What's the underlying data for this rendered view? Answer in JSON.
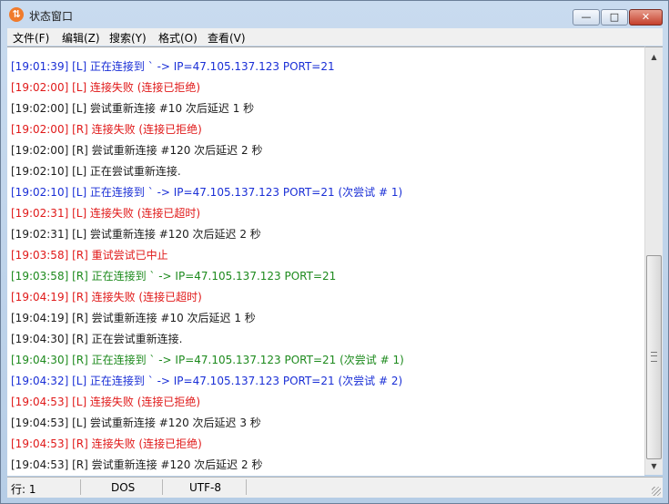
{
  "window": {
    "title": "状态窗口",
    "icon": "ftp-app-icon",
    "close_glyph": "✕",
    "min_glyph": "—",
    "max_glyph": "□"
  },
  "menu": [
    {
      "label": "文件(F)"
    },
    {
      "label": "编辑(Z)"
    },
    {
      "label": "搜索(Y)"
    },
    {
      "label": "格式(O)"
    },
    {
      "label": "查看(V)"
    }
  ],
  "log": [
    {
      "text": "[19:01:39] [L] 正在连接到 ` -> IP=47.105.137.123 PORT=21",
      "color": "blue"
    },
    {
      "text": "[19:02:00] [L] 连接失败 (连接已拒绝)",
      "color": "red"
    },
    {
      "text": "[19:02:00] [L] 尝试重新连接 #10 次后延迟 1 秒",
      "color": "black"
    },
    {
      "text": "[19:02:00] [R] 连接失败 (连接已拒绝)",
      "color": "red"
    },
    {
      "text": "[19:02:00] [R] 尝试重新连接 #120 次后延迟 2 秒",
      "color": "black"
    },
    {
      "text": "[19:02:10] [L] 正在尝试重新连接.",
      "color": "black"
    },
    {
      "text": "[19:02:10] [L] 正在连接到 ` -> IP=47.105.137.123 PORT=21 (次尝试 # 1)",
      "color": "blue"
    },
    {
      "text": "[19:02:31] [L] 连接失败 (连接已超时)",
      "color": "red"
    },
    {
      "text": "[19:02:31] [L] 尝试重新连接 #120 次后延迟 2 秒",
      "color": "black"
    },
    {
      "text": "[19:03:58] [R] 重试尝试已中止",
      "color": "red"
    },
    {
      "text": "[19:03:58] [R] 正在连接到 ` -> IP=47.105.137.123 PORT=21",
      "color": "green"
    },
    {
      "text": "[19:04:19] [R] 连接失败 (连接已超时)",
      "color": "red"
    },
    {
      "text": "[19:04:19] [R] 尝试重新连接 #10 次后延迟 1 秒",
      "color": "black"
    },
    {
      "text": "[19:04:30] [R] 正在尝试重新连接.",
      "color": "black"
    },
    {
      "text": "[19:04:30] [R] 正在连接到 ` -> IP=47.105.137.123 PORT=21 (次尝试 # 1)",
      "color": "green"
    },
    {
      "text": "[19:04:32] [L] 正在连接到 ` -> IP=47.105.137.123 PORT=21 (次尝试 # 2)",
      "color": "blue"
    },
    {
      "text": "[19:04:53] [L] 连接失败 (连接已拒绝)",
      "color": "red"
    },
    {
      "text": "[19:04:53] [L] 尝试重新连接 #120 次后延迟 3 秒",
      "color": "black"
    },
    {
      "text": "[19:04:53] [R] 连接失败 (连接已拒绝)",
      "color": "red"
    },
    {
      "text": "[19:04:53] [R] 尝试重新连接 #120 次后延迟 2 秒",
      "color": "black"
    }
  ],
  "status": {
    "position": "行: 1",
    "line_ending": "DOS",
    "encoding": "UTF-8"
  },
  "colors": {
    "blue": "#1a2fd6",
    "red": "#e01919",
    "black": "#1c1c1c",
    "green": "#1d8a1d"
  }
}
